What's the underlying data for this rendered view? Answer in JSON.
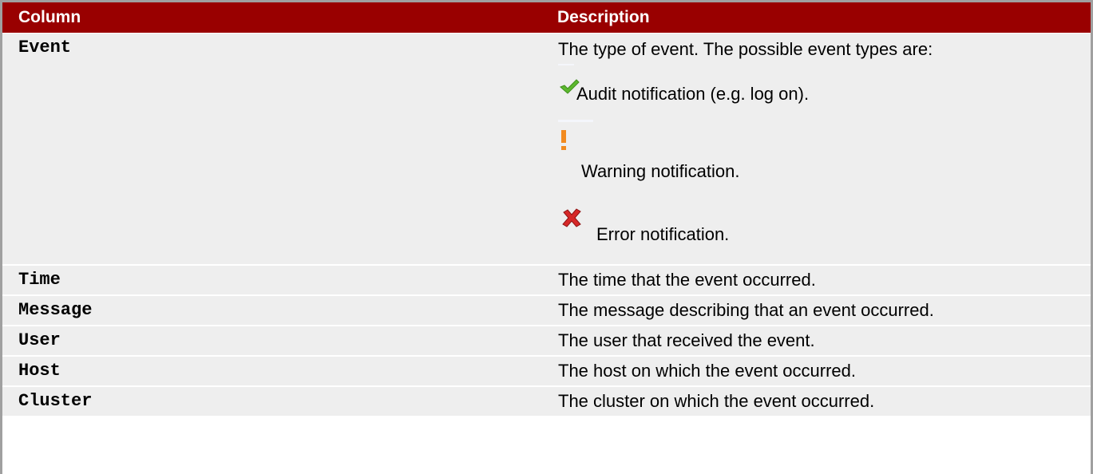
{
  "table": {
    "headers": {
      "column": "Column",
      "description": "Description"
    },
    "event_row": {
      "name": "Event",
      "intro": "The type of event. The possible event types are:",
      "types": [
        {
          "icon": "check-icon",
          "label": "Audit notification (e.g. log on)."
        },
        {
          "icon": "exclamation-icon",
          "label": "Warning notification."
        },
        {
          "icon": "error-x-icon",
          "label": "Error notification."
        }
      ]
    },
    "rows": [
      {
        "name": "Time",
        "description": "The time that the event occurred."
      },
      {
        "name": "Message",
        "description": "The message describing that an event occurred."
      },
      {
        "name": "User",
        "description": "The user that received the event."
      },
      {
        "name": "Host",
        "description": "The host on which the event occurred."
      },
      {
        "name": "Cluster",
        "description": "The cluster on which the event occurred."
      }
    ]
  },
  "colors": {
    "header_bg": "#990000",
    "row_bg": "#eeeeee",
    "check": "#5cb82e",
    "warning": "#f28a1f",
    "error": "#d62828"
  }
}
